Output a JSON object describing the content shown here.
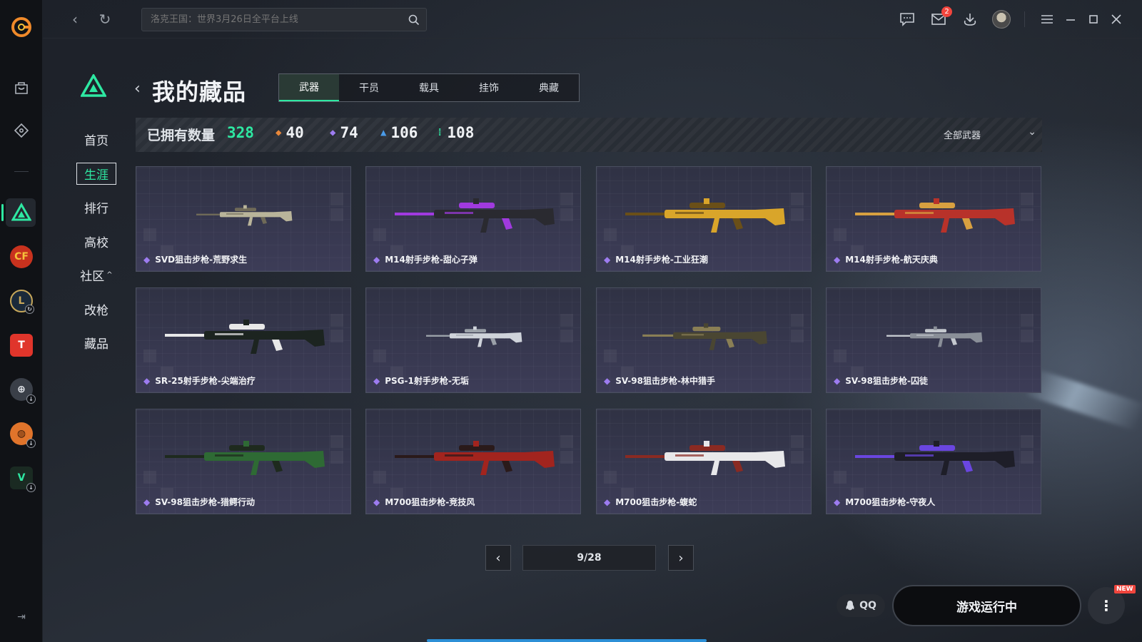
{
  "topbar": {
    "search_placeholder": "洛克王国：世界3月26日全平台上线",
    "mail_badge": "2"
  },
  "sidebar": {
    "items": [
      {
        "label": "首页"
      },
      {
        "label": "生涯"
      },
      {
        "label": "排行"
      },
      {
        "label": "高校"
      },
      {
        "label": "社区",
        "caret": "^"
      },
      {
        "label": "改枪"
      },
      {
        "label": "藏品"
      }
    ]
  },
  "header": {
    "title": "我的藏品",
    "tabs": [
      "武器",
      "干员",
      "载具",
      "挂饰",
      "典藏"
    ],
    "active_tab": "武器"
  },
  "stats": {
    "label": "已拥有数量",
    "total": "328",
    "rarities": [
      {
        "value": "40",
        "color": "#e8873a"
      },
      {
        "value": "74",
        "color": "#9d7cf0"
      },
      {
        "value": "106",
        "color": "#4a9be8"
      },
      {
        "value": "108",
        "color": "#2ee8a2"
      }
    ],
    "filter_label": "全部武器"
  },
  "items": [
    {
      "name": "SVD狙击步枪-荒野求生",
      "colors": [
        "#b9b49a",
        "#6f6a58"
      ]
    },
    {
      "name": "M14射手步枪-甜心子弹",
      "colors": [
        "#2a2a30",
        "#a03adf"
      ]
    },
    {
      "name": "M14射手步枪-工业狂潮",
      "colors": [
        "#d9a52a",
        "#6a4f18"
      ]
    },
    {
      "name": "M14射手步枪-航天庆典",
      "colors": [
        "#b8322a",
        "#d8a040"
      ]
    },
    {
      "name": "SR-25射手步枪-尖端治疗",
      "colors": [
        "#1c2420",
        "#e8e8e8"
      ]
    },
    {
      "name": "PSG-1射手步枪-无垢",
      "colors": [
        "#cfd3da",
        "#9aa0a8"
      ]
    },
    {
      "name": "SV-98狙击步枪-林中猎手",
      "colors": [
        "#4a4632",
        "#8a7f55"
      ]
    },
    {
      "name": "SV-98狙击步枪-囚徒",
      "colors": [
        "#8a8f98",
        "#c4c8ce"
      ]
    },
    {
      "name": "SV-98狙击步枪-猎鳄行动",
      "colors": [
        "#2e6a34",
        "#1e2a1e"
      ]
    },
    {
      "name": "M700狙击步枪-竞技风",
      "colors": [
        "#a2241e",
        "#2a1a1a"
      ]
    },
    {
      "name": "M700狙击步枪-蝮蛇",
      "colors": [
        "#e8e8ea",
        "#8a2a22"
      ]
    },
    {
      "name": "M700狙击步枪-守夜人",
      "colors": [
        "#1e1e28",
        "#6a46e0"
      ]
    }
  ],
  "pager": {
    "current": "9/28"
  },
  "footer": {
    "qq_label": "QQ",
    "run_label": "游戏运行中",
    "new_tag": "NEW"
  }
}
